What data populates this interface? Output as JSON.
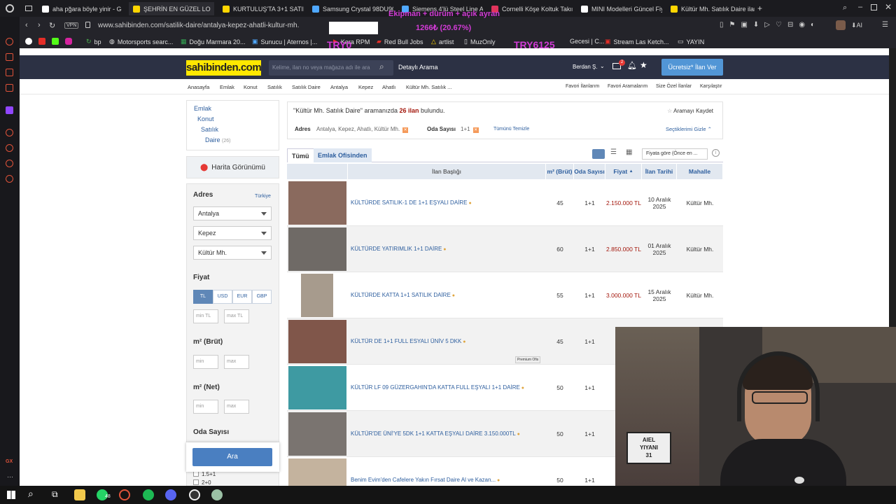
{
  "browser": {
    "tabs": [
      {
        "label": "aha pğara böyle yinir - Go",
        "color": "#fff"
      },
      {
        "label": "ŞEHRİN EN GÜZEL LO",
        "color": "#ffd600",
        "active": true
      },
      {
        "label": "KURTULUŞ'TA 3+1 SATILI",
        "color": "#ffd600"
      },
      {
        "label": "Samsung Crystal 98DU90",
        "color": "#4fa8ff"
      },
      {
        "label": "Siemens 4'lü Steel Line A",
        "color": "#4fa8ff"
      },
      {
        "label": "Cornelli Köşe Koltuk Takım",
        "color": "#e0345c"
      },
      {
        "label": "MINI Modelleri Güncel Fiy",
        "color": "#fff"
      },
      {
        "label": "Kültür Mh. Satılık Daire ilan",
        "color": "#ffd600"
      }
    ],
    "url": "www.sahibinden.com/satilik-daire/antalya-kepez-ahatli-kultur-mh.",
    "vpn": "VPN",
    "bookmarks": [
      "bp",
      "Motorsports searc...",
      "Doğu Marmara 20...",
      "Sunucu | Aternos |...",
      "Kara RPM",
      "Red Bull Jobs",
      "artlist",
      "MuzOnly",
      "Gecesi | C...",
      "Stream Las Ketch...",
      "YAYIN"
    ],
    "overlay": {
      "line1": "Ekipman + dürüm + açık ayran",
      "line2": "1266₺ (20.67%)",
      "try_left": "TRY0",
      "try_right": "TRY6125"
    }
  },
  "header": {
    "logo": "sahibinden.com",
    "search_placeholder": "Kelime, ilan no veya mağaza adı ile ara",
    "detail_search": "Detaylı Arama",
    "user": "Berdan Ş.",
    "notif_count": "2",
    "post_button": "Ücretsiz* İlan Ver"
  },
  "breadcrumbs": [
    "Anasayfa",
    "Emlak",
    "Konut",
    "Satılık",
    "Satılık Daire",
    "Antalya",
    "Kepez",
    "Ahatlı",
    "Kültür Mh. Satılık ..."
  ],
  "right_links": [
    "Favori İlanlarım",
    "Favori Aramalarım",
    "Size Özel İlanlar",
    "Karşılaştır"
  ],
  "categories": {
    "a": "Emlak",
    "b": "Konut",
    "c": "Satılık",
    "d": "Daire",
    "d_count": "(26)"
  },
  "map_view": "Harita Görünümü",
  "filters": {
    "adres_label": "Adres",
    "turkiye": "Türkiye",
    "il": "Antalya",
    "ilce": "Kepez",
    "mahalle": "Kültür Mh.",
    "fiyat_label": "Fiyat",
    "currencies": [
      "TL",
      "USD",
      "EUR",
      "GBP"
    ],
    "min_tl": "min TL",
    "max_tl": "max TL",
    "brut_label": "m² (Brüt)",
    "net_label": "m² (Net)",
    "min": "min",
    "max": "max",
    "oda_label": "Oda Sayısı",
    "oda_opt1": "1.5+1",
    "oda_opt2": "2+0",
    "search_button": "Ara"
  },
  "results": {
    "query": "\"Kültür Mh. Satılık Daire\"",
    "query_suffix": "aramanızda",
    "count": "26 ilan",
    "found": "bulundu.",
    "save_search": "Aramayı Kaydet",
    "adres_chip_label": "Adres",
    "adres_chip_value": "Antalya, Kepez, Ahatlı, Kültür Mh.",
    "oda_chip_label": "Oda Sayısı",
    "oda_chip_value": "1+1",
    "clear_all": "Tümünü Temizle",
    "hide_selected": "Seçtiklerimi Gizle",
    "tab_all": "Tümü",
    "tab_office": "Emlak Ofisinden",
    "sort": "Fiyata göre (Önce en ...",
    "columns": {
      "title": "İlan Başlığı",
      "m2": "m² (Brüt)",
      "rooms": "Oda Sayısı",
      "price": "Fiyat",
      "date": "İlan Tarihi",
      "district": "Mahalle"
    },
    "premium": "Premium Ofis",
    "rows": [
      {
        "title": "KÜLTÜRDE SATILIK-1 DE 1+1 EŞYALI DAİRE",
        "m2": "45",
        "rooms": "1+1",
        "price": "2.150.000 TL",
        "date": "10 Aralık 2025",
        "district": "Kültür Mh."
      },
      {
        "title": "KÜLTÜRDE YATIRIMLIK 1+1 DAİRE",
        "m2": "60",
        "rooms": "1+1",
        "price": "2.850.000 TL",
        "date": "01 Aralık 2025",
        "district": "Kültür Mh."
      },
      {
        "title": "KÜLTÜRDE KATTA 1+1 SATILIK DAİRE",
        "m2": "55",
        "rooms": "1+1",
        "price": "3.000.000 TL",
        "date": "15 Aralık 2025",
        "district": "Kültür Mh."
      },
      {
        "title": "KÜLTÜR DE 1+1 FULL ESYALI ÜNİV 5 DKK",
        "m2": "45",
        "rooms": "1+1",
        "price": "3.1",
        "date": "",
        "district": ""
      },
      {
        "title": "KÜLTÜR LF 09 GÜZERGAHIN'DA KATTA FULL EŞYALI 1+1 DAİRE",
        "m2": "50",
        "rooms": "1+1",
        "price": "3.1",
        "date": "",
        "district": ""
      },
      {
        "title": "KÜLTÜR'DE ÜNİ'YE 5DK 1+1 KATTA EŞYALI DAİRE 3.150.000TL",
        "m2": "50",
        "rooms": "1+1",
        "price": "3.1",
        "date": "",
        "district": ""
      },
      {
        "title": "Benim Evim'den Cafelere Yakın Fırsat Daire Al ve Kazan...",
        "m2": "50",
        "rooms": "1+1",
        "price": "3.1",
        "date": "",
        "district": ""
      }
    ]
  },
  "webcam": {
    "board_line1": "AIEL",
    "board_line2": "YIYANI",
    "board_line3": "31"
  },
  "taskbar": {
    "badge": "48"
  }
}
